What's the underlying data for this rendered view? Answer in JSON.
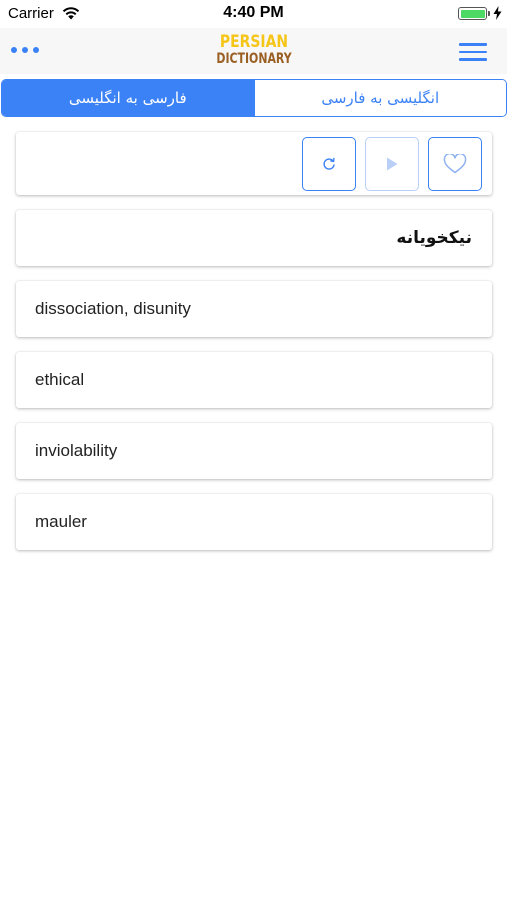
{
  "status_bar": {
    "carrier": "Carrier",
    "time": "4:40 PM",
    "battery_level": 1.0
  },
  "nav": {
    "logo_line1": "PERSIAN",
    "logo_line2": "DICTIONARY",
    "more_icon": "ellipsis-icon",
    "menu_icon": "hamburger-icon"
  },
  "segment": {
    "left_label": "فارسی به انگلیسی",
    "right_label": "انگلیسی به فارسی",
    "selected": "left"
  },
  "toolbar": {
    "refresh_icon": "refresh-icon",
    "play_icon": "play-icon",
    "favorite_icon": "heart-icon"
  },
  "word": "نیکخویانه",
  "results": [
    "dissociation, disunity",
    "ethical",
    "inviolability",
    "mauler"
  ],
  "colors": {
    "accent": "#3b82f6",
    "logo_yellow": "#f5c518",
    "logo_brown": "#9a5f23",
    "battery_green": "#4cd964"
  }
}
